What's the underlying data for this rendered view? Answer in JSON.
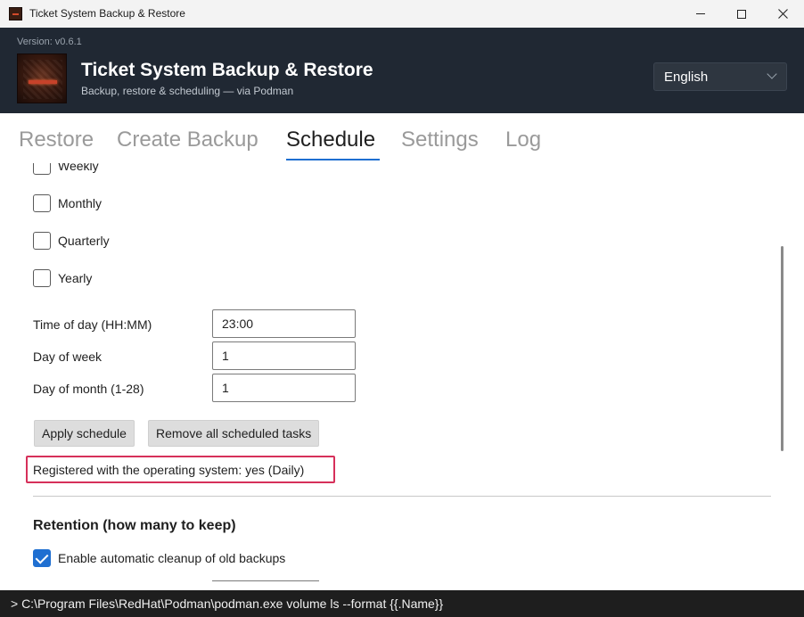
{
  "window": {
    "title": "Ticket System Backup & Restore"
  },
  "header": {
    "version": "Version: v0.6.1",
    "title": "Ticket System Backup & Restore",
    "subtitle": "Backup, restore & scheduling — via Podman",
    "language": "English"
  },
  "tabs": [
    "Restore",
    "Create Backup",
    "Schedule",
    "Settings",
    "Log"
  ],
  "active_tab": "Schedule",
  "schedule": {
    "frequencies": [
      {
        "label": "Weekly",
        "checked": false
      },
      {
        "label": "Monthly",
        "checked": false
      },
      {
        "label": "Quarterly",
        "checked": false
      },
      {
        "label": "Yearly",
        "checked": false
      }
    ],
    "time_of_day": {
      "label": "Time of day (HH:MM)",
      "value": "23:00"
    },
    "day_of_week": {
      "label": "Day of week",
      "value": "1"
    },
    "day_of_month": {
      "label": "Day of month (1-28)",
      "value": "1"
    },
    "apply_button": "Apply schedule",
    "remove_button": "Remove all scheduled tasks",
    "status": "Registered with the operating system: yes (Daily)"
  },
  "retention": {
    "title": "Retention (how many to keep)",
    "cleanup_label": "Enable automatic cleanup of old backups",
    "cleanup_checked": true
  },
  "console": {
    "text": "> C:\\Program Files\\RedHat\\Podman\\podman.exe volume ls --format {{.Name}}"
  },
  "colors": {
    "accent": "#1f6fd1",
    "header_bg": "#202833",
    "highlight": "#d6305a",
    "console_bg": "#1e1e1e"
  }
}
